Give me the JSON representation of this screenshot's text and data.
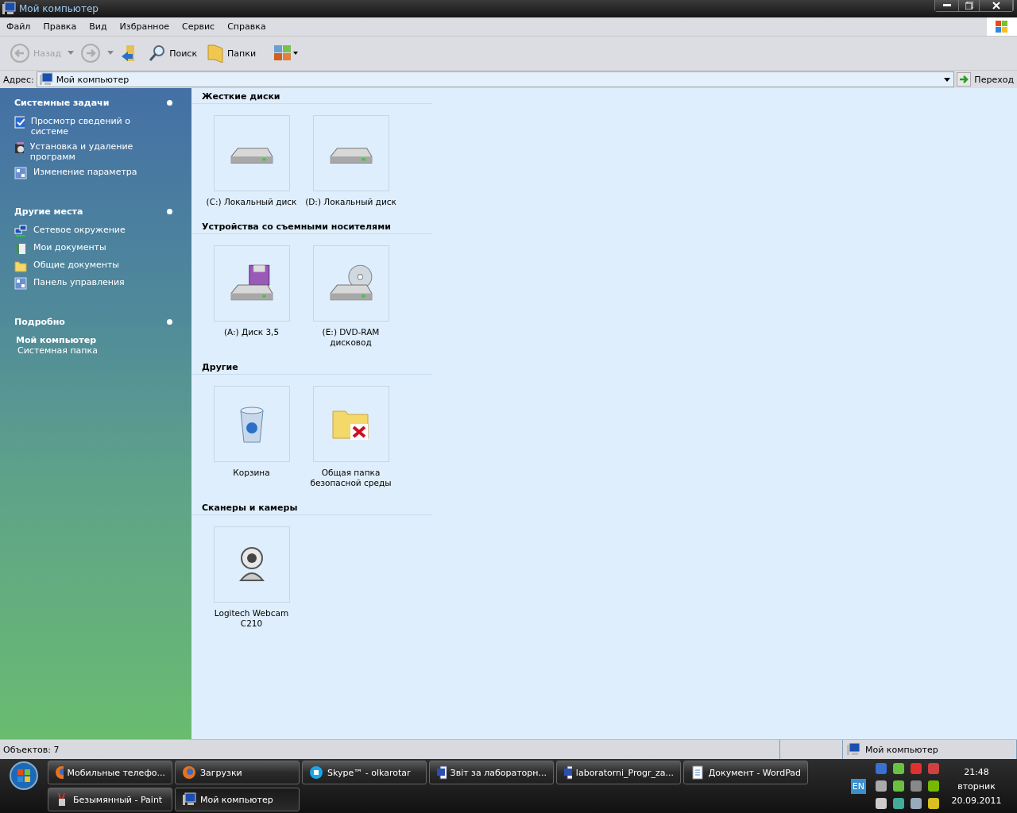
{
  "window": {
    "title": "Мой компьютер"
  },
  "menu": [
    "Файл",
    "Правка",
    "Вид",
    "Избранное",
    "Сервис",
    "Справка"
  ],
  "toolbar": [
    {
      "kind": "back",
      "label": "Назад",
      "disabled": true
    },
    {
      "kind": "forward",
      "disabled": true
    },
    {
      "kind": "up",
      "disabled": false
    },
    {
      "kind": "search",
      "label": "Поиск",
      "disabled": false
    },
    {
      "kind": "folders",
      "label": "Папки",
      "disabled": false
    },
    {
      "kind": "views",
      "disabled": false
    }
  ],
  "address": {
    "label": "Адрес:",
    "value": "Мой компьютер",
    "go": "Переход"
  },
  "sidebar": {
    "panels": [
      {
        "title": "Системные задачи",
        "items": [
          {
            "label": "Просмотр сведений о системе",
            "kind": "check"
          },
          {
            "label": "Установка и удаление программ",
            "kind": "software"
          },
          {
            "label": "Изменение параметра",
            "kind": "panel"
          }
        ]
      },
      {
        "title": "Другие места",
        "items": [
          {
            "label": "Сетевое окружение",
            "kind": "network"
          },
          {
            "label": "Мои документы",
            "kind": "docs"
          },
          {
            "label": "Общие документы",
            "kind": "folder"
          },
          {
            "label": "Панель управления",
            "kind": "panel"
          }
        ]
      }
    ],
    "details": {
      "title": "Подробно",
      "name": "Мой компьютер",
      "subtitle": "Системная папка"
    }
  },
  "groups": [
    {
      "title": "Жесткие диски",
      "items": [
        {
          "label": "(C:) Локальный диск",
          "kind": "hdd"
        },
        {
          "label": "(D:) Локальный диск",
          "kind": "hdd"
        }
      ]
    },
    {
      "title": "Устройства со съемными носителями",
      "items": [
        {
          "label": "(A:) Диск 3,5",
          "kind": "floppy"
        },
        {
          "label": "(E:) DVD-RAM дисковод",
          "kind": "dvd"
        }
      ]
    },
    {
      "title": "Другие",
      "items": [
        {
          "label": "Корзина",
          "kind": "bin"
        },
        {
          "label": "Общая папка безопасной среды",
          "kind": "shared"
        }
      ]
    },
    {
      "title": "Сканеры и камеры",
      "items": [
        {
          "label": "Logitech Webcam C210",
          "kind": "webcam"
        }
      ]
    }
  ],
  "status_bar": {
    "objects": "Объектов: 7",
    "location": "Мой компьютер"
  },
  "taskbar": {
    "buttons": [
      {
        "label": "Мобильные телефо...",
        "kind": "browser",
        "selected": false
      },
      {
        "label": "Загрузки",
        "kind": "browser",
        "selected": false
      },
      {
        "label": "Skype™ - olkarotar",
        "kind": "chat",
        "selected": false
      },
      {
        "label": "Звіт  за лабораторн...",
        "kind": "word",
        "selected": false
      },
      {
        "label": "laboratorni_Progr_za...",
        "kind": "word",
        "selected": false
      },
      {
        "label": "Документ - WordPad",
        "kind": "doc",
        "selected": false
      },
      {
        "label": "Безымянный - Paint",
        "kind": "paint",
        "selected": false
      },
      {
        "label": "Мой компьютер",
        "kind": "computer",
        "selected": true
      }
    ],
    "language": "EN",
    "time": "21:48",
    "day": "вторник",
    "date": "20.09.2011"
  }
}
